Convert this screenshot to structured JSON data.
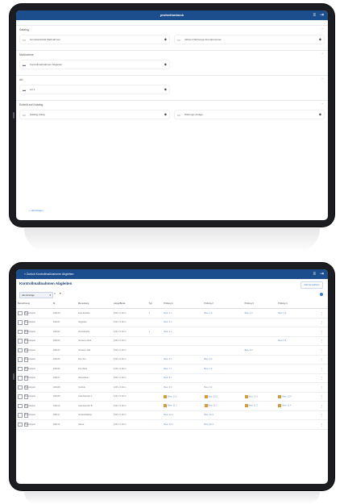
{
  "top_app": {
    "title": "protectionbook",
    "icons": [
      "list-icon",
      "exit-icon"
    ],
    "sections": [
      {
        "label": "Katalog",
        "fields": [
          {
            "icon": "folder-icon",
            "text": "Grundwerkstatt Maßnahmen"
          },
          {
            "icon": "folder-icon",
            "text": "Aktiviert Wartungs-Grundprozesse"
          }
        ]
      },
      {
        "label": "Maßnahme",
        "fields": [
          {
            "icon": "tag-icon",
            "text": "Kontrollmaßnahmen Abgleiten"
          }
        ]
      },
      {
        "label": "Art",
        "fields": [
          {
            "icon": "tag-icon",
            "text": "Art 1"
          }
        ]
      },
      {
        "label": "Erstellt auf Katalog",
        "fields": [
          {
            "icon": "folder-icon",
            "text": "Katalog Anlag"
          },
          {
            "icon": "folder-icon",
            "text": "Wartungs Anlage"
          }
        ]
      }
    ],
    "link": "+ Hinzufügen"
  },
  "bottom_app": {
    "breadcrumb": "« Zurück   Kontrollmaßnahmen Abgleiten",
    "icons": [
      "list-icon",
      "exit-icon"
    ],
    "page_title": "Kontrollmaßnahmen Abgleiten",
    "primary_button": "Alle Auswählen",
    "filter_value": "Alle Einträge",
    "columns": [
      "Bezeichnung",
      "Nr.",
      "Bemerkung",
      "Länge/Breite",
      "Typ",
      "Prüfung 1",
      "Prüfung 2",
      "Prüfung 3",
      "Prüfung 4"
    ],
    "rows": [
      {
        "c": [
          "Basisobjekt",
          "100100",
          "Lied-Einfahrt",
          "0,00 x 0,00 m",
          "1",
          "Bew. 1.1",
          "Bew. 1.2",
          "Bew. 1.3",
          "Bew. 1.4"
        ],
        "badges": false
      },
      {
        "c": [
          "Basisobjekt",
          "100101",
          "Abgleiten",
          "0,00 x 0,00 m",
          "",
          "Bew. 2.1",
          "",
          "",
          ""
        ],
        "badges": false
      },
      {
        "c": [
          "Basisobjekt",
          "100102",
          "Zentralstelle",
          "0,00 x 0,00 m",
          "1",
          "Bew. 3.1",
          "",
          "",
          ""
        ],
        "badges": false
      },
      {
        "c": [
          "Basisobjekt",
          "100103",
          "Vorraum Nord",
          "0,00 x 0,00 m",
          "",
          "",
          "",
          "",
          "Bew. 4.4"
        ],
        "badges": false
      },
      {
        "c": [
          "Basisobjekt",
          "100104",
          "Vorraum Süd",
          "0,00 x 0,00 m",
          "",
          "",
          "",
          "Bew. 5.3",
          ""
        ],
        "badges": false
      },
      {
        "c": [
          "Basisobjekt",
          "100105",
          "Flur Ost",
          "0,00 x 0,00 m",
          "",
          "Bew. 6.1",
          "Bew. 6.2",
          "",
          ""
        ],
        "badges": false
      },
      {
        "c": [
          "Basisobjekt",
          "100106",
          "Flur West",
          "0,00 x 0,00 m",
          "",
          "Bew. 7.1",
          "Bew. 7.2",
          "",
          ""
        ],
        "badges": false
      },
      {
        "c": [
          "Basisobjekt",
          "100107",
          "Abstellraum",
          "0,00 x 0,00 m",
          "",
          "Bew. 8.1",
          "",
          "",
          ""
        ],
        "badges": false
      },
      {
        "c": [
          "Basisobjekt",
          "100108",
          "Technik",
          "0,00 x 0,00 m",
          "",
          "Bew. 9.1",
          "Bew. 9.2",
          "",
          ""
        ],
        "badges": false
      },
      {
        "c": [
          "Basisobjekt",
          "100109",
          "Lieferbereich A",
          "0,00 x 0,00 m",
          "",
          "Bew. 10.1",
          "Bew. 10.2",
          "Bew. 10.3",
          "Bew. 10.4"
        ],
        "badges": true
      },
      {
        "c": [
          "Basisobjekt",
          "100110",
          "Lieferbereich B",
          "0,00 x 0,00 m",
          "",
          "Bew. 11.1",
          "Bew. 11.2",
          "Bew. 11.3",
          "Bew. 11.4"
        ],
        "badges": true
      },
      {
        "c": [
          "Basisobjekt",
          "100111",
          "Verkaufsfläche",
          "0,00 x 0,00 m",
          "",
          "Bew. 12.1",
          "Bew. 12.2",
          "",
          ""
        ],
        "badges": false
      },
      {
        "c": [
          "Basisobjekt",
          "100112",
          "Kasse",
          "0,00 x 0,00 m",
          "",
          "Bew. 13.1",
          "Bew. 13.2",
          "",
          ""
        ],
        "badges": false
      }
    ]
  }
}
